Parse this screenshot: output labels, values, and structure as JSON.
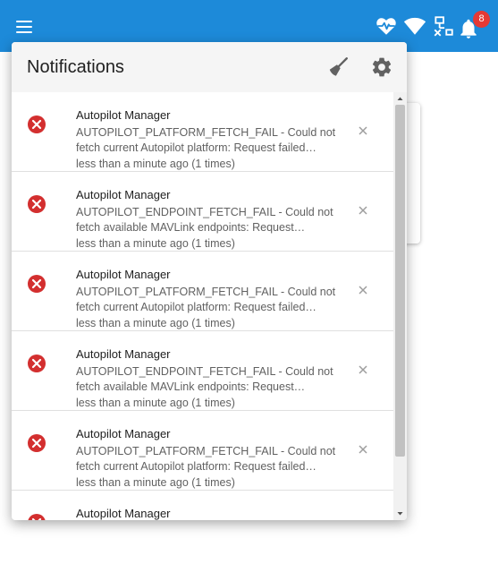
{
  "app_bar": {
    "color": "#1d8ad9",
    "menu_icon": "menu-icon",
    "status_icons": [
      "heart-pulse-icon",
      "wifi-icon",
      "network-disconnected-icon",
      "bell-icon"
    ],
    "notification_count": "8"
  },
  "panel": {
    "title": "Notifications",
    "clear_icon": "broom-icon",
    "settings_icon": "gear-icon"
  },
  "notifications": [
    {
      "title": "Autopilot Manager",
      "message": "AUTOPILOT_PLATFORM_FETCH_FAIL - Could not fetch current Autopilot platform: Request failed…",
      "time": "less than a minute ago (1 times)",
      "status_icon": "error-circle-icon",
      "status_color": "#d32f2f"
    },
    {
      "title": "Autopilot Manager",
      "message": "AUTOPILOT_ENDPOINT_FETCH_FAIL - Could not fetch available MAVLink endpoints: Request…",
      "time": "less than a minute ago (1 times)",
      "status_icon": "error-circle-icon",
      "status_color": "#d32f2f"
    },
    {
      "title": "Autopilot Manager",
      "message": "AUTOPILOT_PLATFORM_FETCH_FAIL - Could not fetch current Autopilot platform: Request failed…",
      "time": "less than a minute ago (1 times)",
      "status_icon": "error-circle-icon",
      "status_color": "#d32f2f"
    },
    {
      "title": "Autopilot Manager",
      "message": "AUTOPILOT_ENDPOINT_FETCH_FAIL - Could not fetch available MAVLink endpoints: Request…",
      "time": "less than a minute ago (1 times)",
      "status_icon": "error-circle-icon",
      "status_color": "#d32f2f"
    },
    {
      "title": "Autopilot Manager",
      "message": "AUTOPILOT_PLATFORM_FETCH_FAIL - Could not fetch current Autopilot platform: Request failed…",
      "time": "less than a minute ago (1 times)",
      "status_icon": "error-circle-icon",
      "status_color": "#d32f2f"
    },
    {
      "title": "Autopilot Manager",
      "message": "",
      "time": "",
      "status_icon": "error-circle-icon",
      "status_color": "#d32f2f"
    }
  ]
}
